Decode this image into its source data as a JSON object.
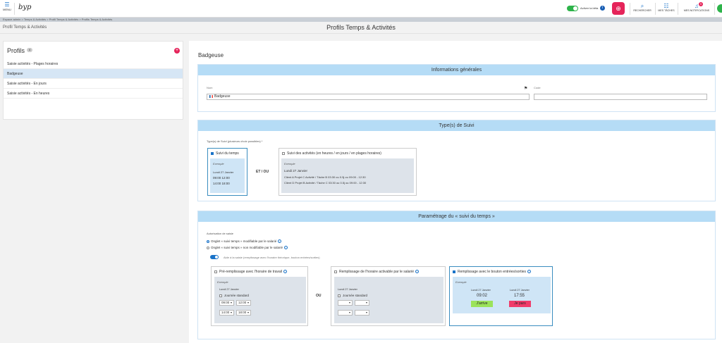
{
  "topbar": {
    "menu_label": "MENU",
    "logo_text": "byp",
    "toggle_label": "Activer la bêta",
    "search_label": "RECHERCHER",
    "tasks_label": "MES TÂCHES",
    "notifications_label": "MES NOTIFICATIONS",
    "notifications_count": "9"
  },
  "breadcrumb": "Espace admin > Temps & Activités > Profil Temps & Activités > Profils Temps & Activités",
  "subheader": {
    "left": "Profil Temps & Activités",
    "title": "Profils Temps & Activités"
  },
  "profiles": {
    "title": "Profils",
    "count": "4",
    "items": [
      {
        "label": "Saisie activités - Plages horaires"
      },
      {
        "label": "Badgeuse"
      },
      {
        "label": "Saisie activités - En jours"
      },
      {
        "label": "Saisie activités - En heures"
      }
    ]
  },
  "main": {
    "title": "Badgeuse",
    "general": {
      "heading": "Informations générales",
      "nom_label": "Nom",
      "nom_value": "Badgeuse",
      "code_label": "Code",
      "code_value": ""
    },
    "types": {
      "heading": "Type(s) de Suivi",
      "hint": "Type(s) de Suivi (plusieurs choix possibles) *",
      "join": "ET / OU",
      "temps": {
        "label": "Suivi du temps",
        "example_title": "Exemple",
        "date": "Lundi 27 Janvier",
        "line1": "09:00   12:00",
        "line2": "14:00   18:00"
      },
      "activites": {
        "label": "Suivi des activités (en heures / en jours / en plages horaires)",
        "example_title": "Exemple",
        "date": "Lundi 27 Janvier",
        "line1": "Client A   Projet C   Activité / Tâche B   03:30 ou 0.5j ou 09:00 - 12:30",
        "line2": "Client D   Projet B   Activité / Tâche C   03:30 ou 0.5j ou 09:00 - 12:30"
      }
    },
    "param": {
      "heading": "Paramétrage du « suivi du temps »",
      "auth_label": "Autorisation de saisie",
      "radio1": "Onglet « suivi temps » modifiable par le salarié",
      "radio2": "Onglet « suivi temps » non modifiable par le salarié",
      "aide_label": "Aide à la saisie (remplissage avec l'horaire théorique, bouton entrées/sorties)",
      "join": "OU",
      "opt1": {
        "label": "Pré-remplissage avec l'horaire de travail",
        "example_title": "Exemple",
        "date": "Lundi 27 Janvier",
        "std": "Journée standard",
        "t1": "09:00",
        "t2": "12:00",
        "t3": "14:00",
        "t4": "18:00"
      },
      "opt2": {
        "label": "Remplissage de l'horaire activable par le salarié",
        "date": "Lundi 27 Janvier",
        "std": "Journée standard"
      },
      "opt3": {
        "label": "Remplissage avec le bouton entrées/sorties",
        "example_title": "Exemple",
        "date1": "Lundi 27 Janvier",
        "date2": "Lundi 27 Janvier",
        "time1": "09:02",
        "time2": "17:55",
        "btn_in": "J'arrive",
        "btn_out": "Je pars"
      }
    }
  },
  "colors": {
    "accent": "#1a73c8",
    "pink": "#e5245a",
    "green": "#2db34a",
    "section_head": "#b5dcf6",
    "btn_in": "#9be35a",
    "btn_out": "#f03b6a"
  }
}
